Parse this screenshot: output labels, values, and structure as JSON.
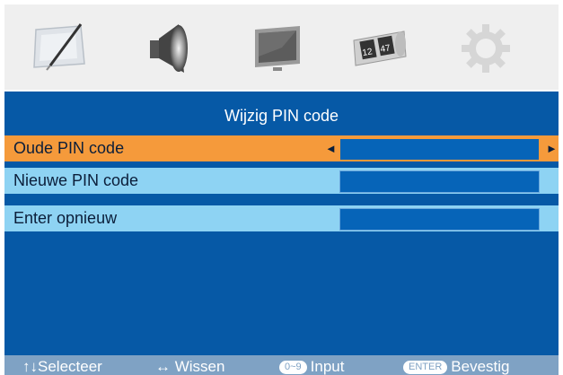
{
  "tabs": [
    {
      "icon": "picture-icon"
    },
    {
      "icon": "sound-icon"
    },
    {
      "icon": "screen-icon"
    },
    {
      "icon": "time-icon",
      "clock_digits": [
        "12",
        "47"
      ]
    },
    {
      "icon": "setup-gear-icon"
    }
  ],
  "menu": {
    "title": "Wijzig PIN code",
    "rows": [
      {
        "label": "Oude PIN code",
        "value": "",
        "selected": true
      },
      {
        "label": "Nieuwe PIN code",
        "value": "",
        "selected": false
      },
      {
        "label": "Enter opnieuw",
        "value": "",
        "selected": false
      }
    ],
    "arrow_left": "◄",
    "arrow_right": "►"
  },
  "hints": {
    "select": {
      "keys": "↑↓",
      "label": "Selecteer"
    },
    "clear": {
      "keys": "↔",
      "label": "Wissen"
    },
    "input": {
      "key": "0~9",
      "label": "Input"
    },
    "confirm": {
      "key": "ENTER",
      "label": "Bevestig"
    }
  },
  "colors": {
    "panel": "#0659a6",
    "row": "#8ed3f3",
    "row_selected": "#f59a3b",
    "field": "#0664b8",
    "hint_bar": "#7fa2c4"
  }
}
